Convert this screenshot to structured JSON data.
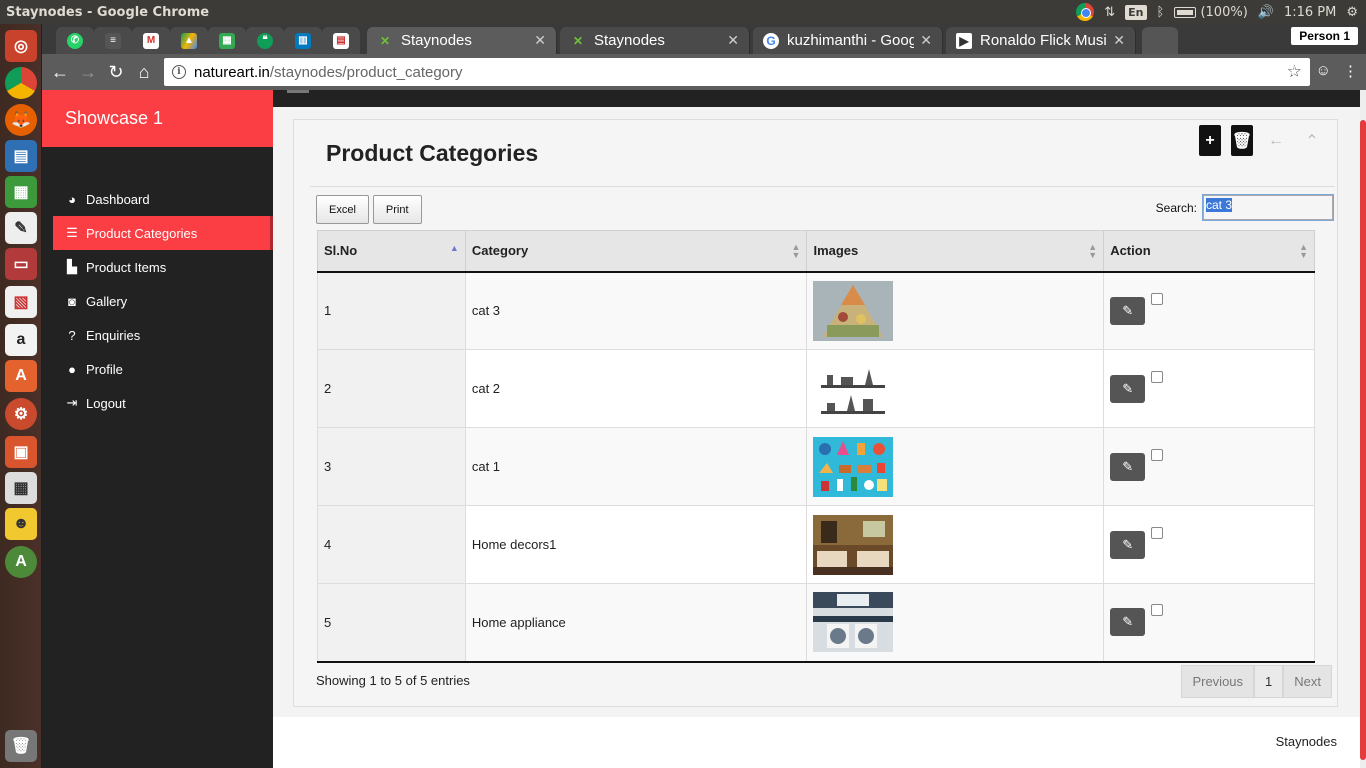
{
  "os": {
    "window_title": "Staynodes - Google Chrome",
    "lang": "En",
    "battery": "(100%)",
    "time": "1:16 PM"
  },
  "browser": {
    "tabs": [
      {
        "title": "Staynodes",
        "active": true
      },
      {
        "title": "Staynodes",
        "active": false
      },
      {
        "title": "kuzhimanthi - Goog",
        "active": false
      },
      {
        "title": "Ronaldo Flick Music",
        "active": false
      }
    ],
    "person": "Person 1",
    "url_host": "natureart.in",
    "url_path": "/staynodes/product_category"
  },
  "sidebar": {
    "brand": "Showcase 1",
    "items": [
      {
        "label": "Dashboard",
        "icon": "dashboard-icon"
      },
      {
        "label": "Product Categories",
        "icon": "list-icon"
      },
      {
        "label": "Product Items",
        "icon": "bag-icon"
      },
      {
        "label": "Gallery",
        "icon": "camera-icon"
      },
      {
        "label": "Enquiries",
        "icon": "question-icon"
      },
      {
        "label": "Profile",
        "icon": "user-icon"
      },
      {
        "label": "Logout",
        "icon": "logout-icon"
      }
    ]
  },
  "main": {
    "title": "Product Categories",
    "buttons": {
      "excel": "Excel",
      "print": "Print"
    },
    "search_label": "Search:",
    "search_value": "cat 3",
    "columns": [
      "Sl.No",
      "Category",
      "Images",
      "Action"
    ],
    "rows": [
      {
        "sl": "1",
        "category": "cat 3"
      },
      {
        "sl": "2",
        "category": "cat 2"
      },
      {
        "sl": "3",
        "category": "cat 1"
      },
      {
        "sl": "4",
        "category": "Home decors1"
      },
      {
        "sl": "5",
        "category": "Home appliance"
      }
    ],
    "info": "Showing 1 to 5 of 5 entries",
    "pagination": {
      "previous": "Previous",
      "page": "1",
      "next": "Next"
    }
  },
  "footer": {
    "text": "Staynodes"
  },
  "colors": {
    "accent": "#fb3d44",
    "sidebar": "#222222"
  }
}
